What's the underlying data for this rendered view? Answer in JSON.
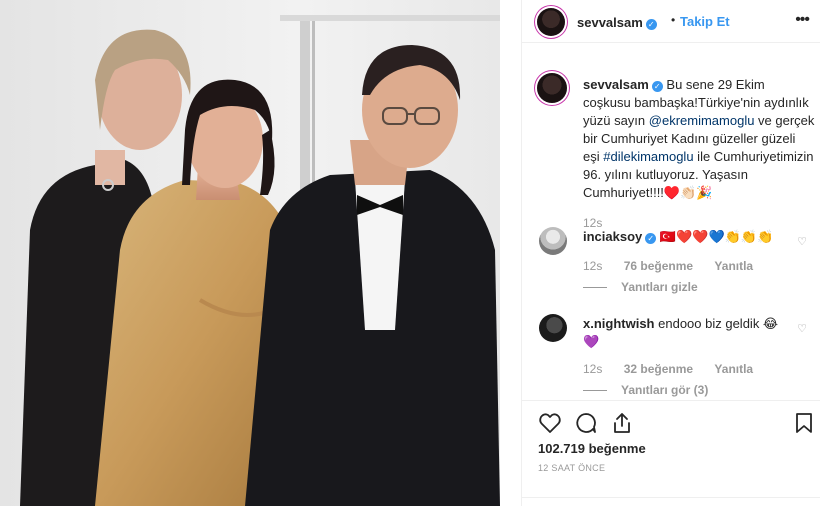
{
  "post": {
    "username": "sevvalsam",
    "follow_label": "Takip Et",
    "dot": "•",
    "more_icon": "more-horizontal-icon",
    "caption_parts": {
      "p1": "Bu sene 29 Ekim coşkusu bambaşka!Türkiye'nin aydınlık yüzü sayın ",
      "mention1": "@ekremimamoglu",
      "p2": " ve gerçek bir Cumhuriyet Kadını güzeller güzeli eşi ",
      "mention2": "#dilekimamoglu",
      "p3": " ile Cumhuriyetimizin 96. yılını kutluyoruz. Yaşasın Cumhuriyet!!!!♥️👏🏻🎉"
    },
    "caption_time": "12s",
    "likes": "102.719 beğenme",
    "posted_ago": "12 SAAT ÖNCE"
  },
  "comments": [
    {
      "username": "inciaksoy",
      "text": "🇹🇷❤️❤️💙👏👏👏",
      "time": "12s",
      "likes": "76 beğenme",
      "reply": "Yanıtla",
      "replies_toggle": "Yanıtları gizle"
    },
    {
      "username": "x.nightwish",
      "text": "endooo biz geldik 😂💜",
      "time": "12s",
      "likes": "32 beğenme",
      "reply": "Yanıtla",
      "replies_toggle": "Yanıtları gör (3)"
    }
  ],
  "colors": {
    "link": "#3897f0",
    "hashtag": "#003569",
    "muted": "#999999",
    "text": "#262626"
  }
}
